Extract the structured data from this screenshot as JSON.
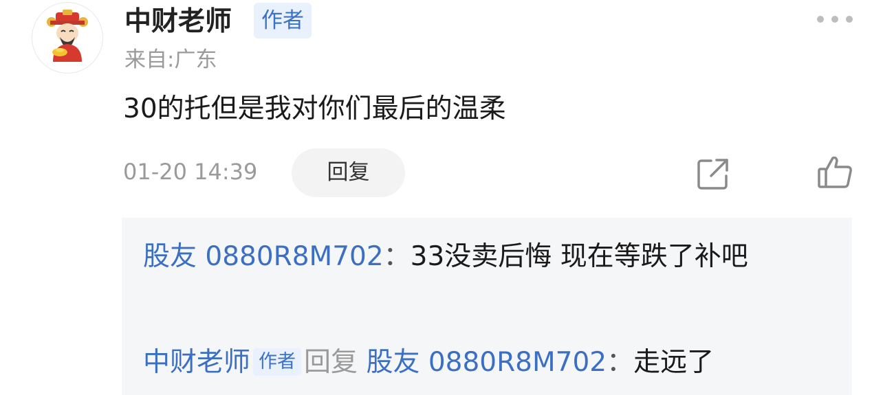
{
  "comment": {
    "author": "中财老师",
    "author_badge": "作者",
    "location": "来自:广东",
    "text": "30的托但是我对你们最后的温柔",
    "timestamp": "01-20 14:39",
    "reply_label": "回复",
    "icons": {
      "avatar": "fortune-god-avatar",
      "more": "more-dots-icon",
      "share": "share-icon",
      "like": "thumbs-up-icon"
    }
  },
  "replies": [
    {
      "user": "股友 0880R8M702",
      "separator": "：",
      "text": "33没卖后悔 现在等跌了补吧"
    },
    {
      "user": "中财老师",
      "badge": "作者",
      "verb": "回复",
      "target": "股友 0880R8M702",
      "separator": "：",
      "text": "走远了"
    }
  ],
  "colors": {
    "link": "#3a6fc4",
    "badge_bg": "#e9f1fc",
    "badge_text": "#3b72c5",
    "muted": "#9a9a9a",
    "panel_bg": "#f5f6f8"
  }
}
